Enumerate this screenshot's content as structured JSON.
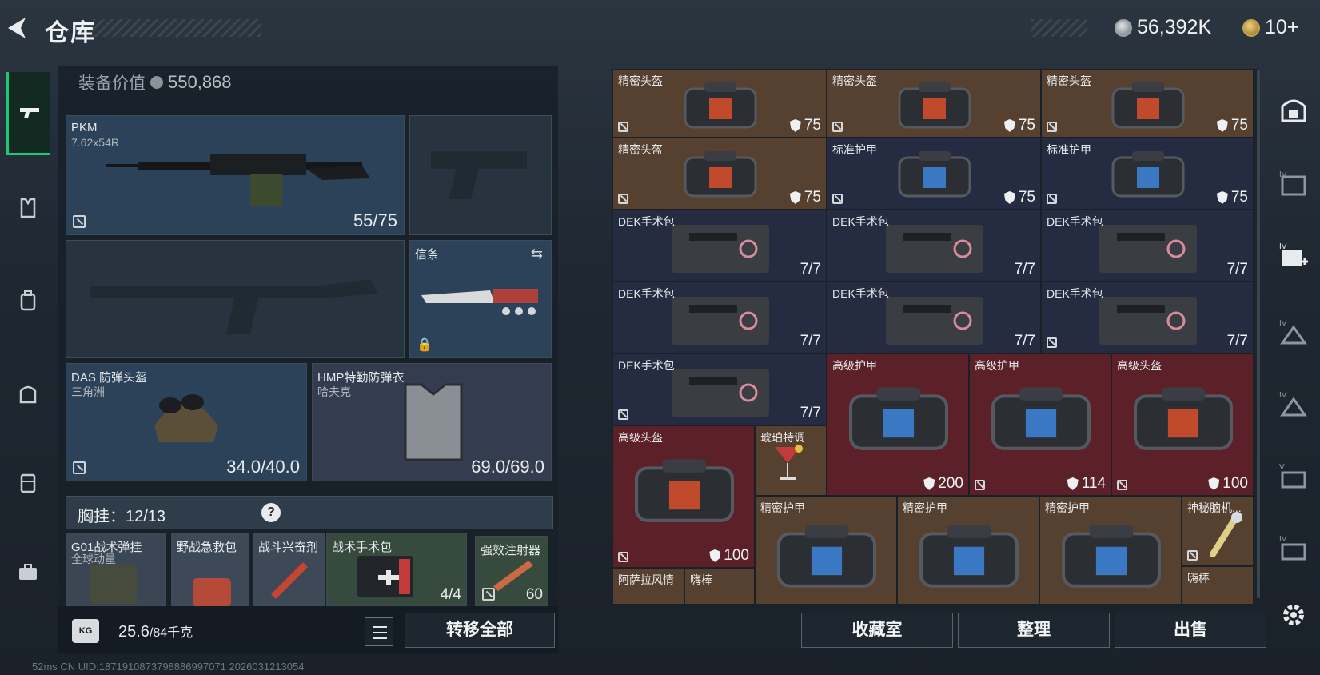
{
  "header": {
    "title": "仓库",
    "silver": "56,392K",
    "gold": "10+"
  },
  "equipment": {
    "value_label": "装备价值",
    "value": "550,868",
    "primary": {
      "name": "PKM",
      "ammo": "7.62x54R",
      "durability": "55/75"
    },
    "melee": {
      "name": "信条"
    },
    "helmet": {
      "name": "DAS 防弹头盔",
      "brand": "三角洲",
      "durability": "34.0/40.0"
    },
    "armor": {
      "name": "HMP特勤防弹衣",
      "brand": "哈夫克",
      "durability": "69.0/69.0"
    },
    "vest": {
      "label": "胸挂：12/13",
      "help": "?"
    },
    "vest_items": [
      {
        "name": "G01战术弹挂",
        "sub": "全球动量"
      },
      {
        "name": "野战急救包"
      },
      {
        "name": "战斗兴奋剂"
      },
      {
        "name": "战术手术包",
        "count": "4/4"
      },
      {
        "name": "强效注射器",
        "count": "60"
      }
    ]
  },
  "footer": {
    "weight": "25.6",
    "weight_max": "/84千克",
    "weight_icon": "KG",
    "transfer_all": "转移全部",
    "collection": "收藏室",
    "organize": "整理",
    "sell": "出售",
    "status": "52ms      CN UID:1871910873798886997071  2026031213054"
  },
  "storage": [
    {
      "name": "精密头盔",
      "value": "75",
      "shield": true
    },
    {
      "name": "精密头盔",
      "value": "75",
      "shield": true
    },
    {
      "name": "精密头盔",
      "value": "75",
      "shield": true
    },
    {
      "name": "精密头盔",
      "value": "75",
      "shield": true
    },
    {
      "name": "标准护甲",
      "value": "75",
      "shield": true
    },
    {
      "name": "标准护甲",
      "value": "75",
      "shield": true
    },
    {
      "name": "DEK手术包",
      "value": "7/7"
    },
    {
      "name": "DEK手术包",
      "value": "7/7"
    },
    {
      "name": "DEK手术包",
      "value": "7/7"
    },
    {
      "name": "DEK手术包",
      "value": "7/7"
    },
    {
      "name": "DEK手术包",
      "value": "7/7"
    },
    {
      "name": "DEK手术包",
      "value": "7/7"
    },
    {
      "name": "DEK手术包",
      "value": "7/7"
    },
    {
      "name": "高级护甲",
      "value": "200",
      "shield": true
    },
    {
      "name": "高级护甲",
      "value": "114",
      "shield": true
    },
    {
      "name": "高级头盔",
      "value": "100",
      "shield": true
    },
    {
      "name": "高级头盔",
      "value": "100",
      "shield": true
    },
    {
      "name": "琥珀特调",
      "value": ""
    },
    {
      "name": "精密护甲",
      "value": ""
    },
    {
      "name": "精密护甲",
      "value": ""
    },
    {
      "name": "精密护甲",
      "value": ""
    },
    {
      "name": "神秘脑机...",
      "value": ""
    },
    {
      "name": "阿萨拉风情",
      "value": ""
    },
    {
      "name": "嗨棒",
      "value": ""
    },
    {
      "name": "嗨棒",
      "value": ""
    }
  ],
  "right_nav": [
    "safe-box",
    "IV",
    "IV+",
    "IV",
    "IV",
    "V",
    "IV"
  ],
  "colors": {
    "brown": "#56402f",
    "navy": "#252c42",
    "red": "#5c2128",
    "active": "#20c67a"
  }
}
